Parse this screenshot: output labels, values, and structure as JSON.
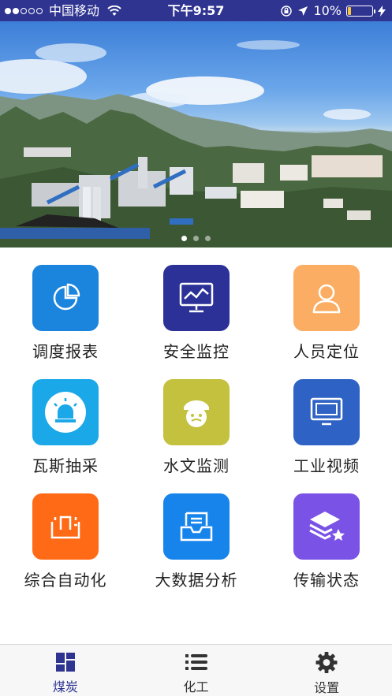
{
  "status_bar": {
    "carrier": "中国移动",
    "time": "下午9:57",
    "battery_percent": "10%",
    "signal_bars_filled": 2,
    "signal_bars_total": 5,
    "battery_color": "#f6c343"
  },
  "banner": {
    "slides": 3,
    "active_slide": 0
  },
  "tiles": [
    {
      "label": "调度报表",
      "icon": "pie-chart-icon",
      "color": "#1b84dc"
    },
    {
      "label": "安全监控",
      "icon": "monitor-chart-icon",
      "color": "#2b3197"
    },
    {
      "label": "人员定位",
      "icon": "person-icon",
      "color": "#fbae63"
    },
    {
      "label": "瓦斯抽采",
      "icon": "siren-icon",
      "color": "#1aa8e8"
    },
    {
      "label": "水文监测",
      "icon": "inspector-face-icon",
      "color": "#c3c13d"
    },
    {
      "label": "工业视频",
      "icon": "tv-icon",
      "color": "#2e62c4"
    },
    {
      "label": "综合自动化",
      "icon": "automation-icon",
      "color": "#ff6a16"
    },
    {
      "label": "大数据分析",
      "icon": "inbox-data-icon",
      "color": "#1784ec"
    },
    {
      "label": "传输状态",
      "icon": "layers-star-icon",
      "color": "#7a53e6"
    }
  ],
  "tabbar": {
    "items": [
      {
        "label": "煤炭",
        "icon": "grid-icon",
        "active": true
      },
      {
        "label": "化工",
        "icon": "list-icon",
        "active": false
      },
      {
        "label": "设置",
        "icon": "gear-icon",
        "active": false
      }
    ],
    "active_color": "#2f3491"
  }
}
